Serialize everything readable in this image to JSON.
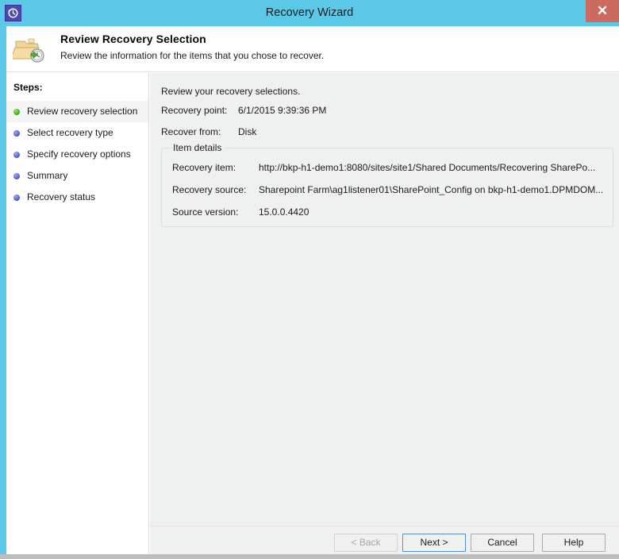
{
  "window": {
    "title": "Recovery Wizard",
    "app_icon": "recovery-clock-icon",
    "close_label": "✕",
    "accent_color": "#5bc8e8",
    "close_color": "#cb6a5f"
  },
  "header": {
    "icon": "folder-recovery-icon",
    "title": "Review Recovery Selection",
    "subtitle": "Review the information for the items that you chose to recover."
  },
  "sidebar": {
    "label": "Steps:",
    "items": [
      {
        "label": "Review recovery selection",
        "state": "current",
        "dot": "green"
      },
      {
        "label": "Select recovery type",
        "state": "pending",
        "dot": "blue"
      },
      {
        "label": "Specify recovery options",
        "state": "pending",
        "dot": "blue"
      },
      {
        "label": "Summary",
        "state": "pending",
        "dot": "blue"
      },
      {
        "label": "Recovery status",
        "state": "pending",
        "dot": "blue"
      }
    ]
  },
  "main": {
    "intro": "Review your recovery selections.",
    "recovery_point_label": "Recovery point:",
    "recovery_point_value": "6/1/2015 9:39:36 PM",
    "recover_from_label": "Recover from:",
    "recover_from_value": "Disk",
    "item_details": {
      "title": "Item details",
      "recovery_item_label": "Recovery item:",
      "recovery_item_value": "http://bkp-h1-demo1:8080/sites/site1/Shared Documents/Recovering SharePo...",
      "recovery_source_label": "Recovery source:",
      "recovery_source_value": "Sharepoint Farm\\ag1listener01\\SharePoint_Config on bkp-h1-demo1.DPMDOM...",
      "source_version_label": "Source version:",
      "source_version_value": "15.0.0.4420"
    }
  },
  "buttons": {
    "back": "< Back",
    "next": "Next >",
    "cancel": "Cancel",
    "help": "Help"
  }
}
